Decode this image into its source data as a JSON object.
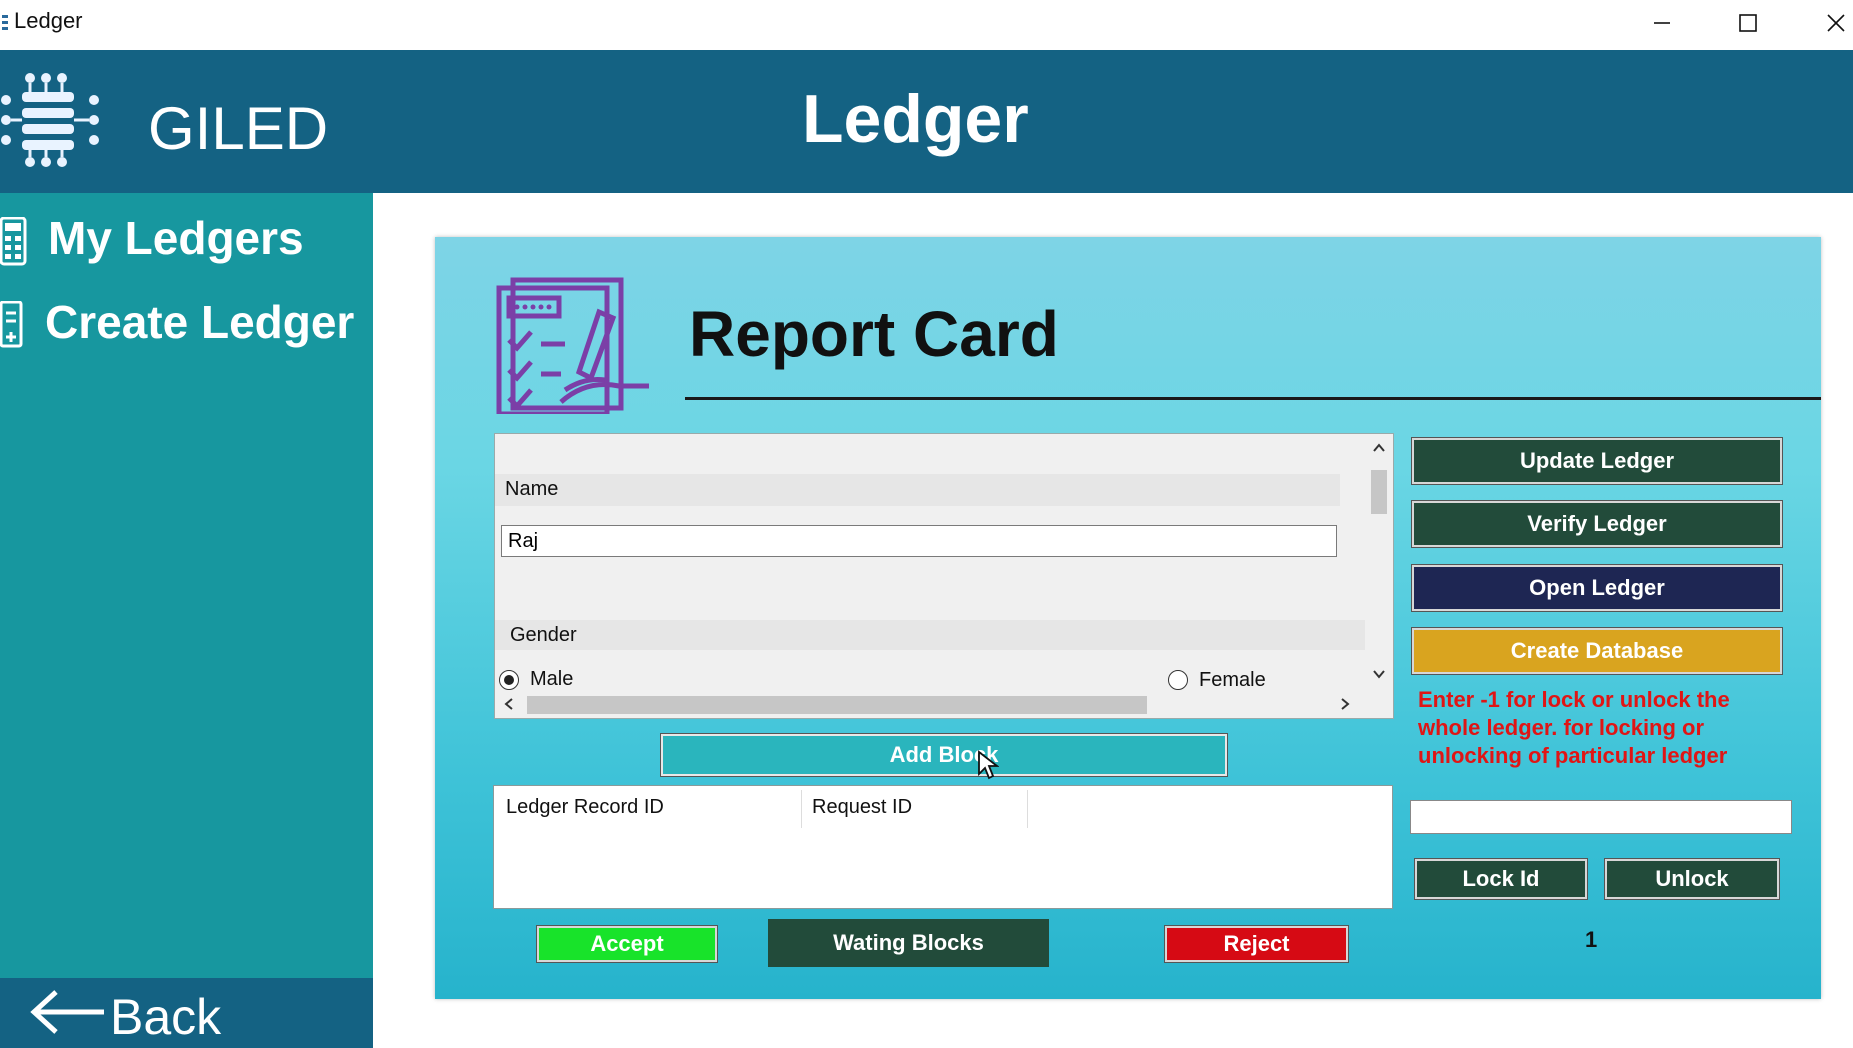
{
  "window": {
    "title": "Ledger"
  },
  "header": {
    "brand": "GILED",
    "page_title": "Ledger"
  },
  "sidebar": {
    "items": [
      {
        "label": "My Ledgers",
        "icon": "calculator-icon"
      },
      {
        "label": "Create Ledger",
        "icon": "new-document-icon"
      }
    ],
    "back_label": "Back"
  },
  "report": {
    "title": "Report Card",
    "form": {
      "name_label": "Name",
      "name_value": "Raj",
      "gender_label": "Gender",
      "gender_options": [
        "Male",
        "Female"
      ],
      "gender_selected": "Male"
    },
    "add_block_label": "Add Block",
    "records": {
      "columns": [
        "Ledger Record ID",
        "Request ID"
      ]
    },
    "accept_label": "Accept",
    "waiting_label": "Wating Blocks",
    "reject_label": "Reject",
    "counter": "1"
  },
  "actions": {
    "update_label": "Update Ledger",
    "verify_label": "Verify Ledger",
    "open_label": "Open Ledger",
    "create_db_label": "Create Database",
    "message": "Enter -1 for lock or unlock the whole ledger. for locking or unlocking of particular ledger",
    "lock_value": "",
    "lock_label": "Lock Id",
    "unlock_label": "Unlock"
  },
  "colors": {
    "header": "#146283",
    "sidebar": "#17979f",
    "dark_green": "#224b3a",
    "navy": "#1e2653",
    "gold": "#d9a41f",
    "teal_button": "#2ab5bd",
    "accept": "#18e32a",
    "reject": "#d60a14",
    "message": "#e01515"
  }
}
